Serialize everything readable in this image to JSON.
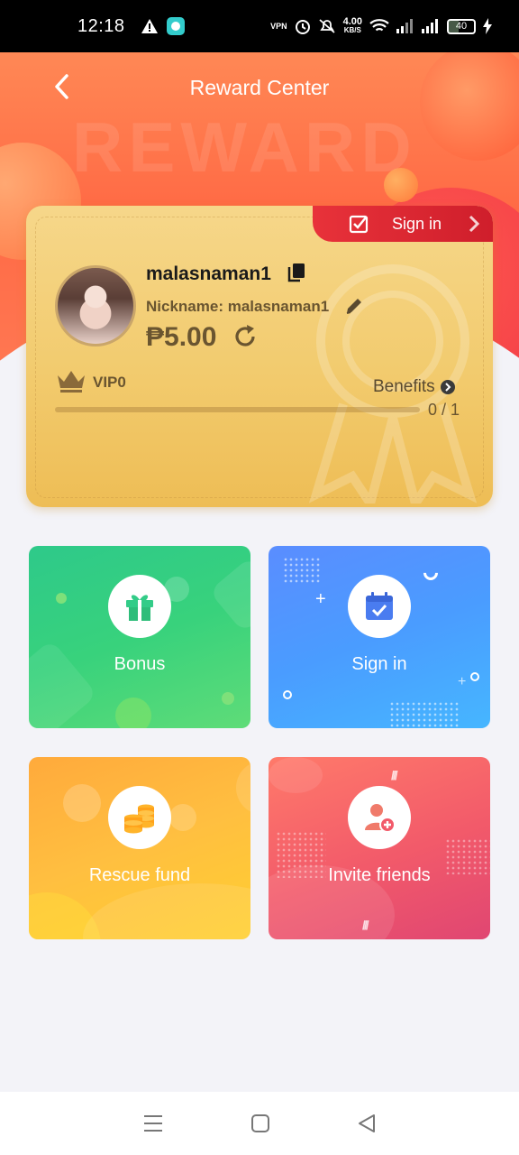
{
  "status_bar": {
    "time": "12:18",
    "vpn": "VPN",
    "speed_value": "4.00",
    "speed_unit": "KB/S",
    "battery": "40"
  },
  "header": {
    "title": "Reward Center",
    "watermark": "REWARD"
  },
  "card": {
    "signin_label": "Sign in",
    "username": "malasnaman1",
    "nickname": "Nickname: malasnaman1",
    "balance": "₱5.00",
    "vip_label": "VIP0",
    "benefits_label": "Benefits",
    "progress_text": "0 / 1",
    "progress_fraction": 0.0
  },
  "tiles": [
    {
      "label": "Bonus"
    },
    {
      "label": "Sign in"
    },
    {
      "label": "Rescue fund"
    },
    {
      "label": "Invite friends"
    }
  ],
  "colors": {
    "accent_red": "#e8323a",
    "gold": "#f2cb6e",
    "bonus_green": "#38d27c",
    "signin_blue": "#4a9cff",
    "rescue_orange": "#ffbf40",
    "invite_pink": "#f25a6a"
  },
  "icons": [
    "back-icon",
    "check-calendar-icon",
    "chevron-right-icon",
    "copy-icon",
    "edit-icon",
    "refresh-icon",
    "crown-icon",
    "gift-icon",
    "calendar-check-icon",
    "coins-icon",
    "add-user-icon",
    "menu-icon",
    "home-icon",
    "back-nav-icon"
  ]
}
